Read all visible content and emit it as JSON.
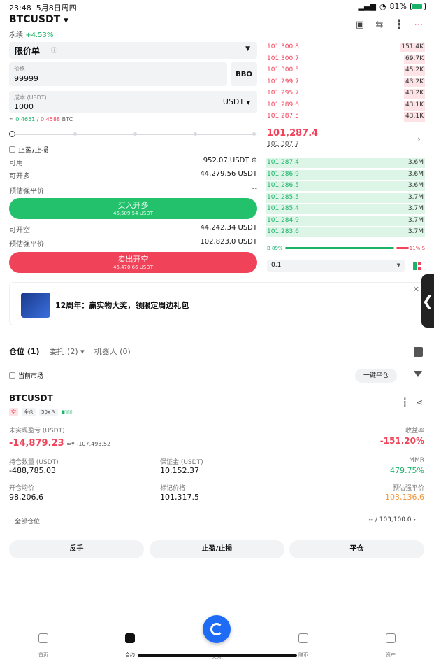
{
  "status_bar": {
    "time": "23:48",
    "date": "5月8日周四",
    "battery": "81%"
  },
  "symbol": {
    "name": "BTCUSDT",
    "type": "永续",
    "change": "+4.53%"
  },
  "top_icons": [
    "gift-icon",
    "exchange-icon",
    "candlestick-icon",
    "more-icon"
  ],
  "order_form": {
    "order_type": "限价单",
    "price_label": "价格",
    "price_value": "99999",
    "bbo_label": "BBO",
    "cost_label": "成本 (USDT)",
    "cost_value": "1000",
    "cost_unit": "USDT",
    "approx_prefix": "≈",
    "approx_long": "0.4651",
    "approx_short": "0.4588",
    "approx_unit": "BTC",
    "tpsl_label": "止盈/止损",
    "available_label": "可用",
    "available_value": "952.07 USDT",
    "can_long_label": "可开多",
    "can_long_value": "44,279.56 USDT",
    "liq_label_long": "预估强平价",
    "liq_value_long": "--",
    "long_button": "买入开多",
    "long_button_sub": "46,509.54 USDT",
    "can_short_label": "可开空",
    "can_short_value": "44,242.34 USDT",
    "liq_label_short": "预估强平价",
    "liq_value_short": "102,823.0 USDT",
    "short_button": "卖出开空",
    "short_button_sub": "46,470.66 USDT"
  },
  "orderbook": {
    "asks": [
      {
        "price": "101,300.8",
        "qty": "151.4K",
        "depth": 0.16
      },
      {
        "price": "101,300.7",
        "qty": "69.7K",
        "depth": 0.13
      },
      {
        "price": "101,300.5",
        "qty": "45.2K",
        "depth": 0.13
      },
      {
        "price": "101,299.7",
        "qty": "43.2K",
        "depth": 0.13
      },
      {
        "price": "101,295.7",
        "qty": "43.2K",
        "depth": 0.13
      },
      {
        "price": "101,289.6",
        "qty": "43.1K",
        "depth": 0.13
      },
      {
        "price": "101,287.5",
        "qty": "43.1K",
        "depth": 0.13
      }
    ],
    "mid_price": "101,287.4",
    "mark_price": "101,307.7",
    "bids": [
      {
        "price": "101,287.4",
        "qty": "3.6M",
        "depth": 1.0
      },
      {
        "price": "101,286.9",
        "qty": "3.6M",
        "depth": 1.0
      },
      {
        "price": "101,286.5",
        "qty": "3.6M",
        "depth": 1.0
      },
      {
        "price": "101,285.5",
        "qty": "3.7M",
        "depth": 1.0
      },
      {
        "price": "101,285.4",
        "qty": "3.7M",
        "depth": 1.0
      },
      {
        "price": "101,284.9",
        "qty": "3.7M",
        "depth": 1.0
      },
      {
        "price": "101,283.6",
        "qty": "3.7M",
        "depth": 1.0
      }
    ],
    "buy_ratio": "B 89%",
    "sell_ratio": "11% S",
    "depth_step": "0.1"
  },
  "banner": {
    "text": "12周年：赢实物大奖，领限定周边礼包"
  },
  "tabs": [
    {
      "label": "仓位 (1)"
    },
    {
      "label": "委托 (2) ▾"
    },
    {
      "label": "机器人 (0)"
    }
  ],
  "filter": {
    "current_market": "当前市场",
    "close_all": "一键平仓"
  },
  "position": {
    "symbol": "BTCUSDT",
    "side": "空",
    "margin_mode": "全仓",
    "leverage": "50x",
    "unrealized_label": "未实现盈亏 (USDT)",
    "unrealized_value": "-14,879.23",
    "unrealized_cny": "≈¥ -107,493.52",
    "roe_label": "收益率",
    "roe_value": "-151.20%",
    "size_label": "持仓数量 (USDT)",
    "size_value": "-488,785.03",
    "margin_label": "保证金 (USDT)",
    "margin_value": "10,152.37",
    "mmr_label": "MMR",
    "mmr_value": "479.75%",
    "entry_label": "开仓均价",
    "entry_value": "98,206.6",
    "mark_label": "标记价格",
    "mark_value": "101,317.5",
    "liq_label": "预估强平价",
    "liq_value": "103,136.6",
    "all_pos_label": "全部仓位",
    "all_pos_value": "-- / 103,100.0"
  },
  "actions": [
    "反手",
    "止盈/止损",
    "平仓"
  ],
  "bottom_nav": [
    {
      "label": "首页",
      "icon": "home-icon"
    },
    {
      "label": "合约",
      "icon": "futures-icon",
      "active": true
    },
    {
      "label": "交易",
      "icon": "trade-icon"
    },
    {
      "label": "赚币",
      "icon": "earn-icon"
    },
    {
      "label": "资产",
      "icon": "wallet-icon"
    }
  ]
}
